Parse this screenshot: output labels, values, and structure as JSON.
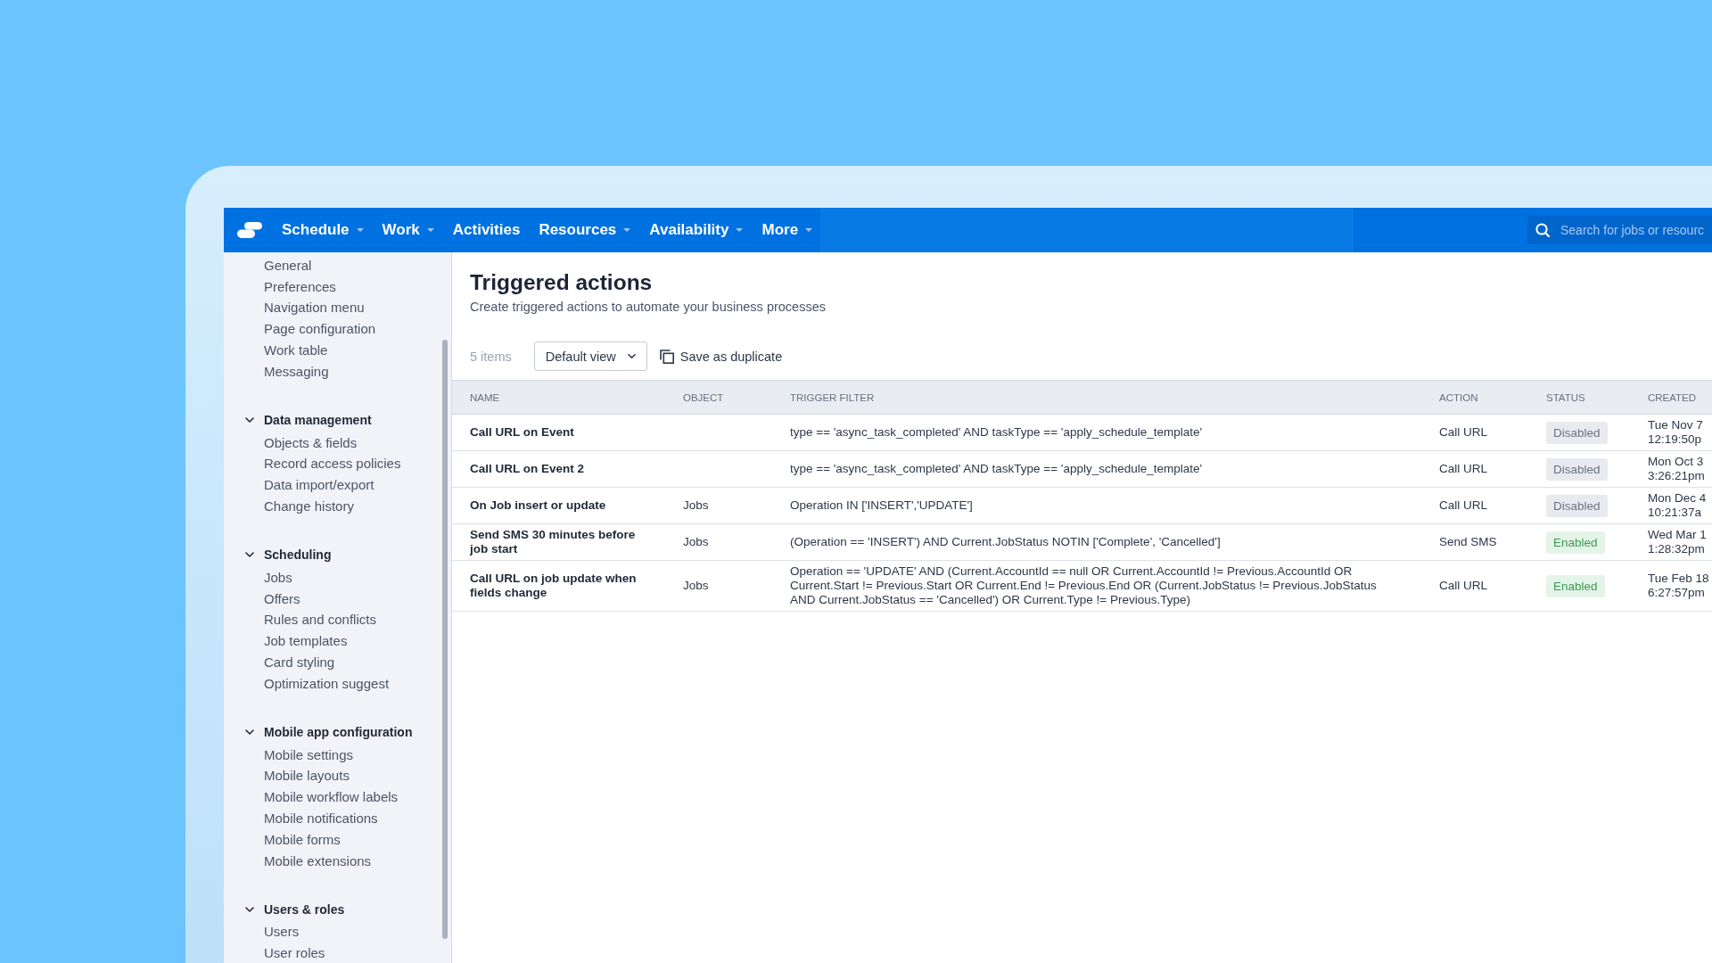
{
  "nav": {
    "items": [
      {
        "label": "Schedule",
        "dropdown": true
      },
      {
        "label": "Work",
        "dropdown": true
      },
      {
        "label": "Activities",
        "dropdown": false
      },
      {
        "label": "Resources",
        "dropdown": true
      },
      {
        "label": "Availability",
        "dropdown": true
      },
      {
        "label": "More",
        "dropdown": true
      }
    ],
    "search": {
      "placeholder": "Search for jobs or resourc"
    }
  },
  "sidebar": {
    "items": [
      {
        "label": "General",
        "selected": false
      },
      {
        "label": "Preferences",
        "selected": false
      },
      {
        "label": "Navigation menu",
        "selected": false
      },
      {
        "label": "Page configuration",
        "selected": false
      },
      {
        "label": "Work table",
        "selected": false
      },
      {
        "label": "Messaging",
        "selected": false
      }
    ],
    "sections": [
      {
        "title": "Data management",
        "expanded": true,
        "items": [
          {
            "label": "Objects & fields",
            "selected": false
          },
          {
            "label": "Record access policies",
            "selected": false
          },
          {
            "label": "Data import/export",
            "selected": false
          },
          {
            "label": "Change history",
            "selected": false
          }
        ]
      },
      {
        "title": "Scheduling",
        "expanded": true,
        "items": [
          {
            "label": "Jobs",
            "selected": false
          },
          {
            "label": "Offers",
            "selected": false
          },
          {
            "label": "Rules and conflicts",
            "selected": false
          },
          {
            "label": "Job templates",
            "selected": false
          },
          {
            "label": "Card styling",
            "selected": false
          },
          {
            "label": "Optimization suggest",
            "selected": false
          }
        ]
      },
      {
        "title": "Mobile app configuration",
        "expanded": true,
        "items": [
          {
            "label": "Mobile settings",
            "selected": false
          },
          {
            "label": "Mobile layouts",
            "selected": false
          },
          {
            "label": "Mobile workflow labels",
            "selected": false
          },
          {
            "label": "Mobile notifications",
            "selected": false
          },
          {
            "label": "Mobile forms",
            "selected": false
          },
          {
            "label": "Mobile extensions",
            "selected": false
          }
        ]
      },
      {
        "title": "Users & roles",
        "expanded": true,
        "items": [
          {
            "label": "Users",
            "selected": false
          },
          {
            "label": "User roles",
            "selected": false
          }
        ]
      }
    ]
  },
  "page": {
    "title": "Triggered actions",
    "subtitle": "Create triggered actions to automate your business processes"
  },
  "toolbar": {
    "count": "5 items",
    "view_select": {
      "value": "Default view"
    },
    "duplicate_button": "Save as duplicate"
  },
  "table": {
    "columns": [
      "NAME",
      "OBJECT",
      "TRIGGER FILTER",
      "ACTION",
      "STATUS",
      "CREATED"
    ],
    "rows": [
      {
        "name": "Call URL on Event",
        "trigger_filter": "type == 'async_task_completed' AND taskType == 'apply_schedule_template'",
        "action": "Call URL",
        "status": {
          "label": "Disabled",
          "enabled": false
        },
        "created": {
          "date": "Tue Nov 7",
          "time": "12:19:50p"
        }
      },
      {
        "name": "Call URL on Event 2",
        "trigger_filter": "type == 'async_task_completed' AND taskType == 'apply_schedule_template'",
        "action": "Call URL",
        "status": {
          "label": "Disabled",
          "enabled": false
        },
        "created": {
          "date": "Mon Oct 3",
          "time": "3:26:21pm"
        }
      },
      {
        "name": "On Job insert or update",
        "object": "Jobs",
        "trigger_filter": "Operation IN ['INSERT','UPDATE']",
        "action": "Call URL",
        "status": {
          "label": "Disabled",
          "enabled": false
        },
        "created": {
          "date": "Mon Dec 4",
          "time": "10:21:37a"
        }
      },
      {
        "name": "Send SMS 30 minutes before job start",
        "object": "Jobs",
        "trigger_filter": "(Operation == 'INSERT') AND Current.JobStatus NOTIN ['Complete', 'Cancelled']",
        "action": "Send SMS",
        "status": {
          "label": "Enabled",
          "enabled": true
        },
        "created": {
          "date": "Wed Mar 1",
          "time": "1:28:32pm"
        }
      },
      {
        "name": "Call URL on job update when fields change",
        "object": "Jobs",
        "trigger_filter": "Operation == 'UPDATE' AND (Current.AccountId == null OR Current.AccountId != Previous.AccountId OR Current.Start != Previous.Start OR Current.End != Previous.End OR (Current.JobStatus != Previous.JobStatus AND Current.JobStatus == 'Cancelled') OR Current.Type != Previous.Type)",
        "action": "Call URL",
        "status": {
          "label": "Enabled",
          "enabled": true
        },
        "created": {
          "date": "Tue Feb 18",
          "time": "6:27:57pm"
        }
      }
    ]
  }
}
